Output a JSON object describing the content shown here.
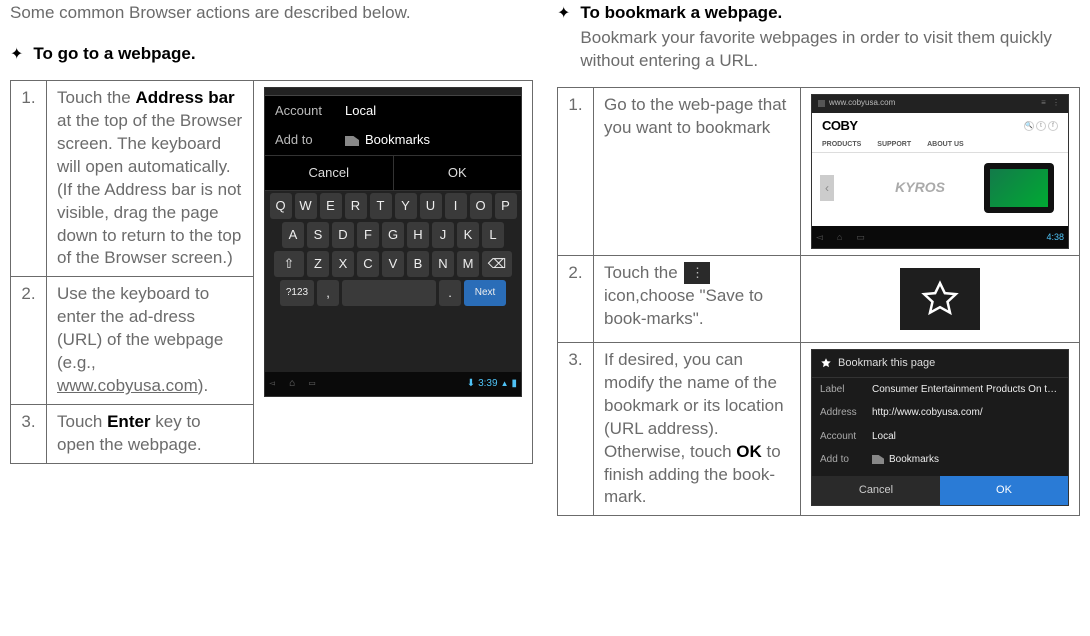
{
  "intro": "Some common Browser actions are described below.",
  "left": {
    "heading": "To go to a webpage.",
    "steps": {
      "s1_num": "1.",
      "s1_a": "Touch the ",
      "s1_b": "Address bar",
      "s1_c": " at the top of the Browser screen. The keyboard will open automatically. (If the Address bar is not visible, drag the page down to return to the top of the Browser screen.)",
      "s2_num": "2.",
      "s2_a": "Use the keyboard to enter the ad-dress (URL) of the webpage (e.g., ",
      "s2_url": "www.cobyusa.com",
      "s2_b": ").",
      "s3_num": "3.",
      "s3_a": "Touch ",
      "s3_b": "Enter",
      "s3_c": " key to open the webpage."
    },
    "mock": {
      "account_lbl": "Account",
      "account_val": "Local",
      "addto_lbl": "Add to",
      "addto_val": "Bookmarks",
      "cancel": "Cancel",
      "ok": "OK",
      "row1": [
        "Q",
        "W",
        "E",
        "R",
        "T",
        "Y",
        "U",
        "I",
        "O",
        "P"
      ],
      "row2": [
        "A",
        "S",
        "D",
        "F",
        "G",
        "H",
        "J",
        "K",
        "L"
      ],
      "row3_shift": "⇧",
      "row3": [
        "Z",
        "X",
        "C",
        "V",
        "B",
        "N",
        "M"
      ],
      "row3_bk": "⌫",
      "sym": "?123",
      "dot": ".",
      "next": "Next",
      "time": "3:39"
    }
  },
  "right": {
    "heading": "To bookmark a webpage.",
    "subtitle": "Bookmark your favorite webpages in order to visit them quickly without entering a URL.",
    "steps": {
      "s1_num": "1.",
      "s1": "Go to the web-page that you want to bookmark",
      "s2_num": "2.",
      "s2_a": "Touch the ",
      "s2_b": " icon,choose \"Save to book-marks\".",
      "s3_num": "3.",
      "s3_a": "If desired, you can modify the name of the bookmark or its location (URL address). Otherwise, touch ",
      "s3_b": "OK",
      "s3_c": " to finish adding the book-mark."
    },
    "mock2": {
      "url": "www.cobyusa.com",
      "logo": "COBY",
      "nav": [
        "PRODUCTS",
        "SUPPORT",
        "ABOUT US"
      ],
      "brand": "KYROS",
      "time": "4:38"
    },
    "mock4": {
      "title": "Bookmark this page",
      "label_lbl": "Label",
      "label_val": "Consumer Entertainment Products On the Go! | COBY",
      "addr_lbl": "Address",
      "addr_val": "http://www.cobyusa.com/",
      "acc_lbl": "Account",
      "acc_val": "Local",
      "addto_lbl": "Add to",
      "addto_val": "Bookmarks",
      "cancel": "Cancel",
      "ok": "OK"
    }
  }
}
